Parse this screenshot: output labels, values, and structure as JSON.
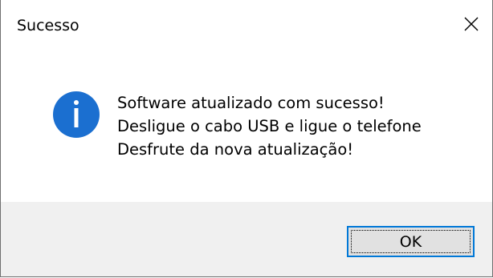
{
  "window": {
    "title": "Sucesso",
    "close_icon": "close-icon"
  },
  "message": {
    "icon": "info-icon",
    "lines": [
      "Software atualizado com sucesso!",
      "Desligue o cabo USB e ligue o telefone",
      "Desfrute da nova atualização!"
    ]
  },
  "buttons": {
    "ok_label": "OK"
  },
  "colors": {
    "info_icon_fill": "#1b6fd0",
    "button_focus_border": "#0078d7",
    "footer_background": "#f0f0f0",
    "button_background": "#e1e1e1"
  }
}
